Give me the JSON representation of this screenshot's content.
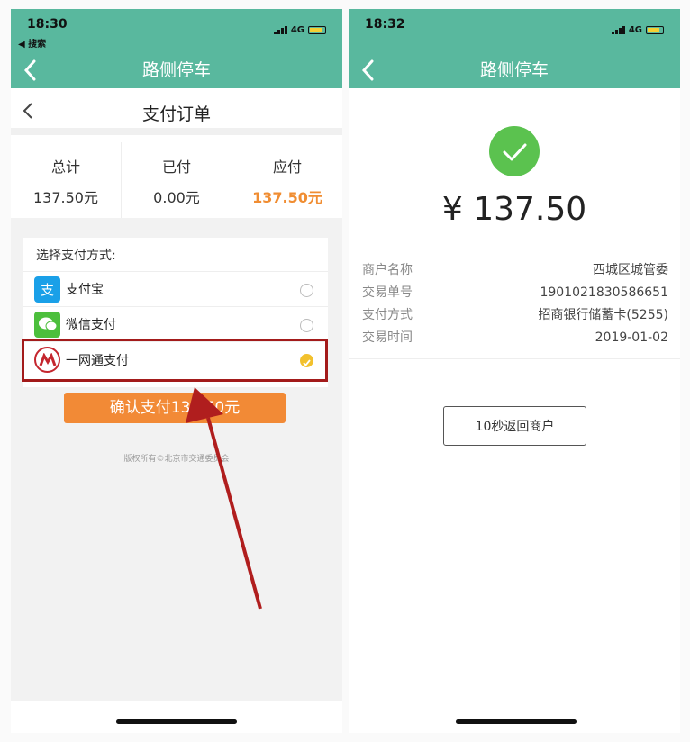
{
  "left": {
    "status": {
      "time": "18:30",
      "back_app": "◀ 搜索",
      "network": "4G"
    },
    "title": "路侧停车",
    "order_title": "支付订单",
    "summary": [
      {
        "label": "总计",
        "value": "137.50元"
      },
      {
        "label": "已付",
        "value": "0.00元"
      },
      {
        "label": "应付",
        "value": "137.50元"
      }
    ],
    "pay_method_heading": "选择支付方式:",
    "methods": [
      {
        "name": "支付宝",
        "icon": "alipay-icon",
        "selected": false
      },
      {
        "name": "微信支付",
        "icon": "wechat-icon",
        "selected": false
      },
      {
        "name": "一网通支付",
        "icon": "cmb-icon",
        "selected": true
      }
    ],
    "confirm_label": "确认支付137.50元",
    "copyright": "版权所有©北京市交通委员会"
  },
  "right": {
    "status": {
      "time": "18:32",
      "network": "4G"
    },
    "title": "路侧停车",
    "amount": "¥ 137.50",
    "details": [
      {
        "key": "商户名称",
        "value": "西城区城管委"
      },
      {
        "key": "交易单号",
        "value": "1901021830586651"
      },
      {
        "key": "支付方式",
        "value": "招商银行储蓄卡(5255)"
      },
      {
        "key": "交易时间",
        "value": "2019-01-02"
      }
    ],
    "return_label": "10秒返回商户"
  },
  "colors": {
    "header": "#59b89e",
    "accent": "#f08d32",
    "success": "#5bc24f",
    "highlight": "#a31b1b"
  }
}
